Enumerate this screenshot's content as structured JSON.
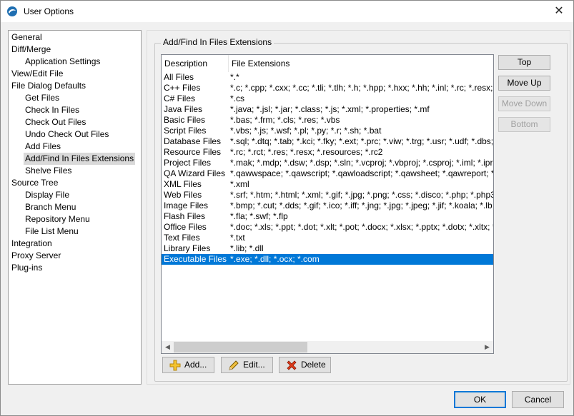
{
  "window": {
    "title": "User Options"
  },
  "tree": [
    {
      "label": "General",
      "level": 0
    },
    {
      "label": "Diff/Merge",
      "level": 0
    },
    {
      "label": "Application Settings",
      "level": 1
    },
    {
      "label": "View/Edit File",
      "level": 0
    },
    {
      "label": "File Dialog Defaults",
      "level": 0
    },
    {
      "label": "Get Files",
      "level": 1
    },
    {
      "label": "Check In Files",
      "level": 1
    },
    {
      "label": "Check Out Files",
      "level": 1
    },
    {
      "label": "Undo Check Out Files",
      "level": 1
    },
    {
      "label": "Add Files",
      "level": 1
    },
    {
      "label": "Add/Find In Files Extensions",
      "level": 1,
      "selected": true
    },
    {
      "label": "Shelve Files",
      "level": 1
    },
    {
      "label": "Source Tree",
      "level": 0
    },
    {
      "label": "Display File",
      "level": 1
    },
    {
      "label": "Branch Menu",
      "level": 1
    },
    {
      "label": "Repository Menu",
      "level": 1
    },
    {
      "label": "File List Menu",
      "level": 1
    },
    {
      "label": "Integration",
      "level": 0
    },
    {
      "label": "Proxy Server",
      "level": 0
    },
    {
      "label": "Plug-ins",
      "level": 0
    }
  ],
  "group": {
    "title": "Add/Find In Files Extensions"
  },
  "list": {
    "columns": [
      "Description",
      "File Extensions"
    ],
    "rows": [
      [
        "All Files",
        "*.*"
      ],
      [
        "C++ Files",
        "*.c; *.cpp; *.cxx; *.cc; *.tli; *.tlh; *.h; *.hpp; *.hxx; *.hh; *.inl; *.rc; *.resx; *.i"
      ],
      [
        "C# Files",
        "*.cs"
      ],
      [
        "Java Files",
        "*.java; *.jsl; *.jar; *.class; *.js; *.xml; *.properties; *.mf"
      ],
      [
        "Basic Files",
        "*.bas; *.frm; *.cls; *.res; *.vbs"
      ],
      [
        "Script Files",
        "*.vbs; *.js; *.wsf; *.pl; *.py; *.r; *.sh; *.bat"
      ],
      [
        "Database Files",
        "*.sql; *.dtq; *.tab; *.kci; *.fky; *.ext; *.prc; *.viw; *.trg; *.usr; *.udf; *.dbs; *"
      ],
      [
        "Resource Files",
        "*.rc; *.rct; *.res; *.resx; *.resources; *.rc2"
      ],
      [
        "Project Files",
        "*.mak; *.mdp; *.dsw; *.dsp; *.sln; *.vcproj; *.vbproj; *.csproj; *.iml; *.ipr"
      ],
      [
        "QA Wizard Files",
        "*.qawwspace; *.qawscript; *.qawloadscript; *.qawsheet; *.qawreport; *.q"
      ],
      [
        "XML Files",
        "*.xml"
      ],
      [
        "Web Files",
        "*.srf; *.htm; *.html; *.xml; *.gif; *.jpg; *.png; *.css; *.disco; *.php; *.php3"
      ],
      [
        "Image Files",
        "*.bmp; *.cut; *.dds; *.gif; *.ico; *.iff; *.jng; *.jpg; *.jpeg; *.jif; *.koala; *.lb"
      ],
      [
        "Flash Files",
        "*.fla; *.swf; *.flp"
      ],
      [
        "Office Files",
        "*.doc; *.xls; *.ppt; *.dot; *.xlt; *.pot; *.docx; *.xlsx; *.pptx; *.dotx; *.xltx; *."
      ],
      [
        "Text Files",
        "*.txt"
      ],
      [
        "Library Files",
        "*.lib; *.dll"
      ],
      [
        "Executable Files",
        "*.exe; *.dll; *.ocx; *.com"
      ]
    ],
    "selected_index": 17
  },
  "side_buttons": {
    "top": "Top",
    "move_up": "Move Up",
    "move_down": "Move Down",
    "bottom": "Bottom"
  },
  "bottom_buttons": {
    "add": "Add...",
    "edit": "Edit...",
    "delete": "Delete"
  },
  "dialog_buttons": {
    "ok": "OK",
    "cancel": "Cancel"
  },
  "colors": {
    "selection": "#0078d7"
  }
}
